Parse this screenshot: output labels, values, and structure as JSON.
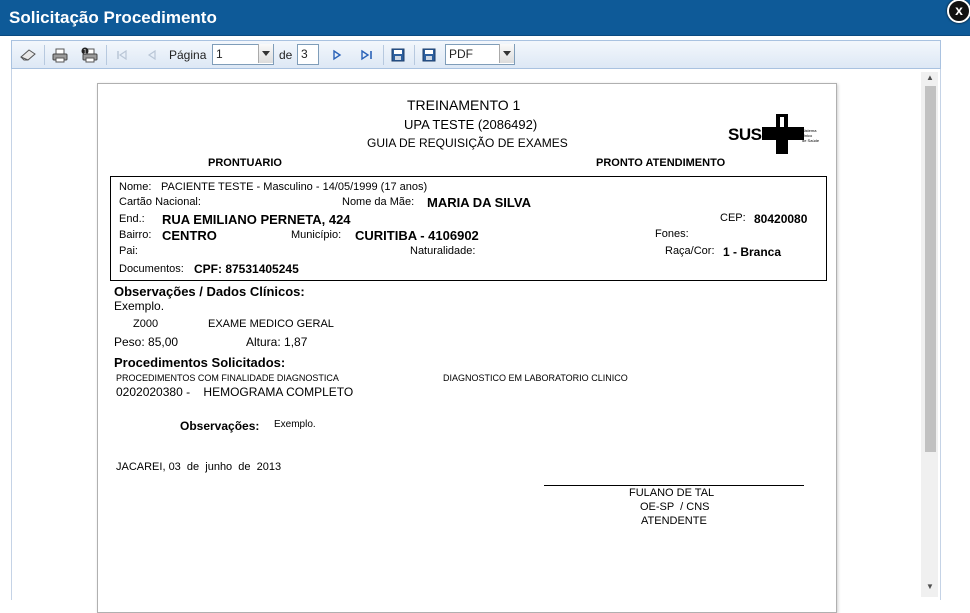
{
  "window": {
    "title": "Solicitação Procedimento",
    "close_label": "x"
  },
  "toolbar": {
    "page_label": "Página",
    "page_value": "1",
    "of_label": "de",
    "total_pages": "3",
    "export_format": "PDF"
  },
  "report": {
    "title": "TREINAMENTO 1",
    "unit": "UPA TESTE (2086492)",
    "subtitle": "GUIA DE REQUISIÇÃO DE EXAMES",
    "logo_text": "SUS",
    "logo_small": [
      "Sistema",
      "Único",
      "de Saúde"
    ],
    "prontuario": "PRONTUARIO",
    "pronto_atendimento": "PRONTO ATENDIMENTO",
    "patient": {
      "nome_label": "Nome:",
      "nome_value": "PACIENTE TESTE - Masculino - 14/05/1999 (17 anos)",
      "cartao_label": "Cartão Nacional:",
      "mae_label": "Nome da Mãe:",
      "mae_value": "MARIA DA SILVA",
      "end_label": "End.:",
      "end_value": "RUA EMILIANO PERNETA, 424",
      "cep_label": "CEP:",
      "cep_value": "80420080",
      "bairro_label": "Bairro:",
      "bairro_value": "CENTRO",
      "municipio_label": "Município:",
      "municipio_value": "CURITIBA - 4106902",
      "fones_label": "Fones:",
      "pai_label": "Pai:",
      "naturalidade_label": "Naturalidade:",
      "raca_label": "Raça/Cor:",
      "raca_value": "1 - Branca",
      "documentos_label": "Documentos:",
      "documentos_value": "CPF: 87531405245"
    },
    "obs_clinicos_title": "Observações / Dados Clínicos:",
    "obs_clinicos_text": "Exemplo.",
    "cid_code": "Z000",
    "cid_desc": "EXAME MEDICO GERAL",
    "peso": "Peso: 85,00",
    "altura": "Altura: 1,87",
    "proc_title": "Procedimentos Solicitados:",
    "proc_group": "PROCEDIMENTOS COM FINALIDADE DIAGNOSTICA",
    "proc_subgroup": "DIAGNOSTICO EM LABORATORIO CLINICO",
    "proc_item": "0202020380 -    HEMOGRAMA COMPLETO",
    "obs_label": "Observações:",
    "obs_value": "Exemplo.",
    "date_line": "JACAREI, 03  de  junho  de  2013",
    "sign_name": "FULANO DE TAL",
    "sign_reg": "OE-SP  / CNS",
    "sign_role": "ATENDENTE"
  }
}
